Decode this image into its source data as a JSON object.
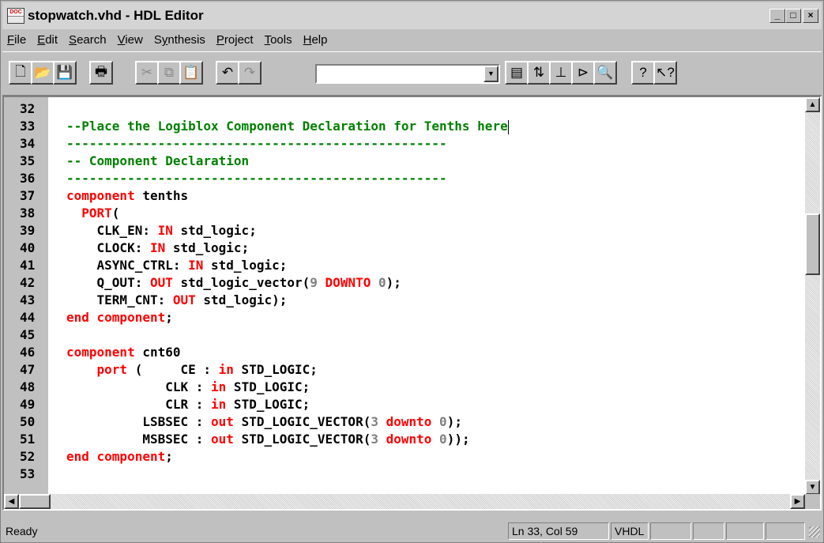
{
  "window": {
    "title": "stopwatch.vhd - HDL Editor",
    "minimize": "_",
    "maximize": "□",
    "close": "×"
  },
  "menu": [
    {
      "label": "File",
      "key": "F"
    },
    {
      "label": "Edit",
      "key": "E"
    },
    {
      "label": "Search",
      "key": "S"
    },
    {
      "label": "View",
      "key": "V"
    },
    {
      "label": "Synthesis",
      "key": "y"
    },
    {
      "label": "Project",
      "key": "P"
    },
    {
      "label": "Tools",
      "key": "T"
    },
    {
      "label": "Help",
      "key": "H"
    }
  ],
  "toolbar": {
    "buttons": [
      {
        "name": "new-icon",
        "glyph": "🗋",
        "disabled": false
      },
      {
        "name": "open-icon",
        "glyph": "📂",
        "disabled": false
      },
      {
        "name": "save-icon",
        "glyph": "💾",
        "disabled": false
      },
      {
        "name": "print-icon",
        "glyph": "🖶",
        "disabled": false
      },
      {
        "name": "cut-icon",
        "glyph": "✂",
        "disabled": true
      },
      {
        "name": "copy-icon",
        "glyph": "⧉",
        "disabled": true
      },
      {
        "name": "paste-icon",
        "glyph": "📋",
        "disabled": false
      },
      {
        "name": "undo-icon",
        "glyph": "↶",
        "disabled": false
      },
      {
        "name": "redo-icon",
        "glyph": "↷",
        "disabled": true
      },
      {
        "name": "language-assistant-icon",
        "glyph": "▤",
        "disabled": false
      },
      {
        "name": "check-syntax-icon",
        "glyph": "⇅",
        "disabled": false
      },
      {
        "name": "synthesize-icon",
        "glyph": "⊥",
        "disabled": false
      },
      {
        "name": "logiblox-icon",
        "glyph": "⊳",
        "disabled": false
      },
      {
        "name": "find-in-design-icon",
        "glyph": "🔍",
        "disabled": false
      },
      {
        "name": "help-icon",
        "glyph": "?",
        "disabled": false
      },
      {
        "name": "context-help-icon",
        "glyph": "↖?",
        "disabled": false
      }
    ],
    "combo_value": ""
  },
  "editor": {
    "lines": [
      {
        "n": "32",
        "tokens": []
      },
      {
        "n": "33",
        "tokens": [
          {
            "t": "--Place the Logiblox Component Declaration for Tenths here",
            "c": "cmt"
          }
        ],
        "cursor": true
      },
      {
        "n": "34",
        "tokens": [
          {
            "t": "--------------------------------------------------",
            "c": "cmt"
          }
        ]
      },
      {
        "n": "35",
        "tokens": [
          {
            "t": "-- Component Declaration",
            "c": "cmt"
          }
        ]
      },
      {
        "n": "36",
        "tokens": [
          {
            "t": "--------------------------------------------------",
            "c": "cmt"
          }
        ]
      },
      {
        "n": "37",
        "tokens": [
          {
            "t": "component",
            "c": "kw"
          },
          {
            "t": " tenths",
            "c": ""
          }
        ]
      },
      {
        "n": "38",
        "tokens": [
          {
            "t": "  PORT",
            "c": "kw"
          },
          {
            "t": "(",
            "c": ""
          }
        ]
      },
      {
        "n": "39",
        "tokens": [
          {
            "t": "    CLK_EN: ",
            "c": ""
          },
          {
            "t": "IN",
            "c": "kw"
          },
          {
            "t": " std_logic;",
            "c": ""
          }
        ]
      },
      {
        "n": "40",
        "tokens": [
          {
            "t": "    CLOCK: ",
            "c": ""
          },
          {
            "t": "IN",
            "c": "kw"
          },
          {
            "t": " std_logic;",
            "c": ""
          }
        ]
      },
      {
        "n": "41",
        "tokens": [
          {
            "t": "    ASYNC_CTRL: ",
            "c": ""
          },
          {
            "t": "IN",
            "c": "kw"
          },
          {
            "t": " std_logic;",
            "c": ""
          }
        ]
      },
      {
        "n": "42",
        "tokens": [
          {
            "t": "    Q_OUT: ",
            "c": ""
          },
          {
            "t": "OUT",
            "c": "kw"
          },
          {
            "t": " std_logic_vector(",
            "c": ""
          },
          {
            "t": "9",
            "c": "num"
          },
          {
            "t": " ",
            "c": ""
          },
          {
            "t": "DOWNTO",
            "c": "kw"
          },
          {
            "t": " ",
            "c": ""
          },
          {
            "t": "0",
            "c": "num"
          },
          {
            "t": ");",
            "c": ""
          }
        ]
      },
      {
        "n": "43",
        "tokens": [
          {
            "t": "    TERM_CNT: ",
            "c": ""
          },
          {
            "t": "OUT",
            "c": "kw"
          },
          {
            "t": " std_logic);",
            "c": ""
          }
        ]
      },
      {
        "n": "44",
        "tokens": [
          {
            "t": "end component",
            "c": "kw"
          },
          {
            "t": ";",
            "c": ""
          }
        ]
      },
      {
        "n": "45",
        "tokens": []
      },
      {
        "n": "46",
        "tokens": [
          {
            "t": "component",
            "c": "kw"
          },
          {
            "t": " cnt60",
            "c": ""
          }
        ]
      },
      {
        "n": "47",
        "tokens": [
          {
            "t": "    port",
            "c": "kw"
          },
          {
            "t": " (     CE : ",
            "c": ""
          },
          {
            "t": "in",
            "c": "kw"
          },
          {
            "t": " STD_LOGIC;",
            "c": ""
          }
        ]
      },
      {
        "n": "48",
        "tokens": [
          {
            "t": "             CLK : ",
            "c": ""
          },
          {
            "t": "in",
            "c": "kw"
          },
          {
            "t": " STD_LOGIC;",
            "c": ""
          }
        ]
      },
      {
        "n": "49",
        "tokens": [
          {
            "t": "             CLR : ",
            "c": ""
          },
          {
            "t": "in",
            "c": "kw"
          },
          {
            "t": " STD_LOGIC;",
            "c": ""
          }
        ]
      },
      {
        "n": "50",
        "tokens": [
          {
            "t": "          LSBSEC : ",
            "c": ""
          },
          {
            "t": "out",
            "c": "kw"
          },
          {
            "t": " STD_LOGIC_VECTOR(",
            "c": ""
          },
          {
            "t": "3",
            "c": "num"
          },
          {
            "t": " ",
            "c": ""
          },
          {
            "t": "downto",
            "c": "kw"
          },
          {
            "t": " ",
            "c": ""
          },
          {
            "t": "0",
            "c": "num"
          },
          {
            "t": ");",
            "c": ""
          }
        ]
      },
      {
        "n": "51",
        "tokens": [
          {
            "t": "          MSBSEC : ",
            "c": ""
          },
          {
            "t": "out",
            "c": "kw"
          },
          {
            "t": " STD_LOGIC_VECTOR(",
            "c": ""
          },
          {
            "t": "3",
            "c": "num"
          },
          {
            "t": " ",
            "c": ""
          },
          {
            "t": "downto",
            "c": "kw"
          },
          {
            "t": " ",
            "c": ""
          },
          {
            "t": "0",
            "c": "num"
          },
          {
            "t": "));",
            "c": ""
          }
        ]
      },
      {
        "n": "52",
        "tokens": [
          {
            "t": "end component",
            "c": "kw"
          },
          {
            "t": ";",
            "c": ""
          }
        ]
      },
      {
        "n": "53",
        "tokens": []
      }
    ],
    "vscroll_position": 0.33
  },
  "status": {
    "message": "Ready",
    "position": "Ln 33, Col 59",
    "language": "VHDL"
  }
}
